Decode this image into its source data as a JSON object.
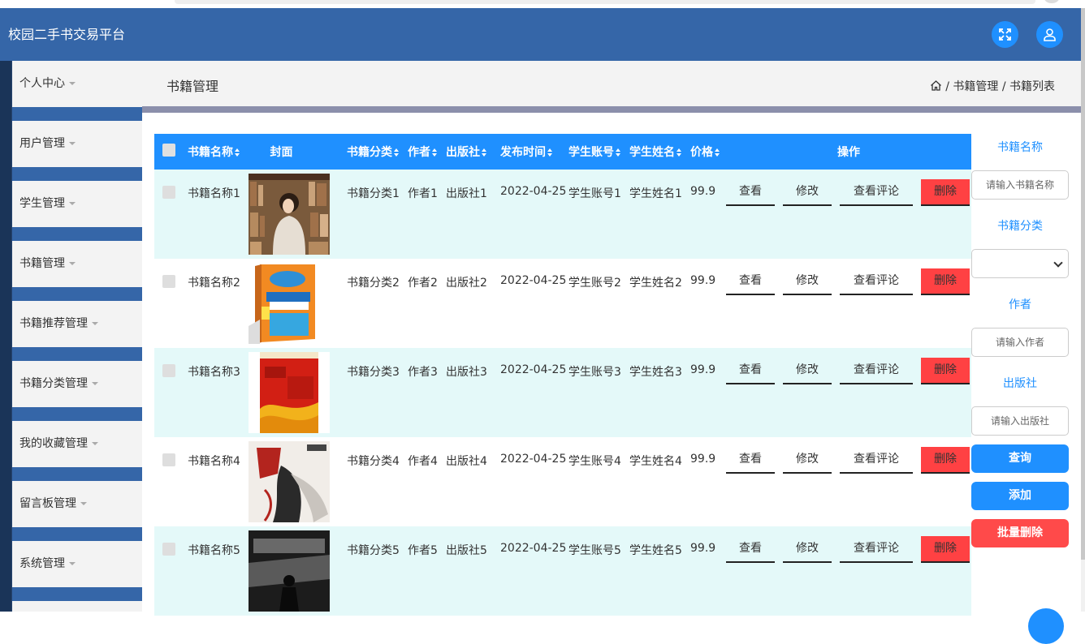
{
  "app": {
    "title": "校园二手书交易平台"
  },
  "header": {
    "fullscreen_icon": "fullscreen-icon",
    "user_icon": "user-icon",
    "accent": "#1f90ff",
    "bg": "#3566a8"
  },
  "sidebar": {
    "items": [
      {
        "label": "个人中心"
      },
      {
        "label": "用户管理"
      },
      {
        "label": "学生管理"
      },
      {
        "label": "书籍管理"
      },
      {
        "label": "书籍推荐管理"
      },
      {
        "label": "书籍分类管理"
      },
      {
        "label": "我的收藏管理"
      },
      {
        "label": "留言板管理"
      },
      {
        "label": "系统管理"
      }
    ]
  },
  "page": {
    "title": "书籍管理",
    "breadcrumb": {
      "home_icon": "home-icon",
      "sep": "/",
      "level1": "书籍管理",
      "level2": "书籍列表"
    }
  },
  "table": {
    "headers": {
      "name": "书籍名称",
      "cover": "封面",
      "category": "书籍分类",
      "author": "作者",
      "publisher": "出版社",
      "date": "发布时间",
      "account": "学生账号",
      "student": "学生姓名",
      "price": "价格",
      "ops": "操作"
    },
    "actions": {
      "view": "查看",
      "edit": "修改",
      "comments": "查看评论",
      "delete": "删除"
    },
    "rows": [
      {
        "name": "书籍名称1",
        "category": "书籍分类1",
        "author": "作者1",
        "publisher": "出版社1",
        "date": "2022-04-25",
        "account": "学生账号1",
        "student": "学生姓名1",
        "price": "99.9"
      },
      {
        "name": "书籍名称2",
        "category": "书籍分类2",
        "author": "作者2",
        "publisher": "出版社2",
        "date": "2022-04-25",
        "account": "学生账号2",
        "student": "学生姓名2",
        "price": "99.9"
      },
      {
        "name": "书籍名称3",
        "category": "书籍分类3",
        "author": "作者3",
        "publisher": "出版社3",
        "date": "2022-04-25",
        "account": "学生账号3",
        "student": "学生姓名3",
        "price": "99.9"
      },
      {
        "name": "书籍名称4",
        "category": "书籍分类4",
        "author": "作者4",
        "publisher": "出版社4",
        "date": "2022-04-25",
        "account": "学生账号4",
        "student": "学生姓名4",
        "price": "99.9"
      },
      {
        "name": "书籍名称5",
        "category": "书籍分类5",
        "author": "作者5",
        "publisher": "出版社5",
        "date": "2022-04-25",
        "account": "学生账号5",
        "student": "学生姓名5",
        "price": "99.9"
      }
    ]
  },
  "search": {
    "name_label": "书籍名称",
    "name_placeholder": "请输入书籍名称",
    "category_label": "书籍分类",
    "category_value": "",
    "author_label": "作者",
    "author_placeholder": "请输入作者",
    "publisher_label": "出版社",
    "publisher_placeholder": "请输入出版社",
    "query_button": "查询",
    "add_button": "添加",
    "batch_delete_button": "批量删除"
  },
  "colors": {
    "primary": "#1f90ff",
    "danger": "#ff4143",
    "row_alt": "#e4f9f9"
  }
}
